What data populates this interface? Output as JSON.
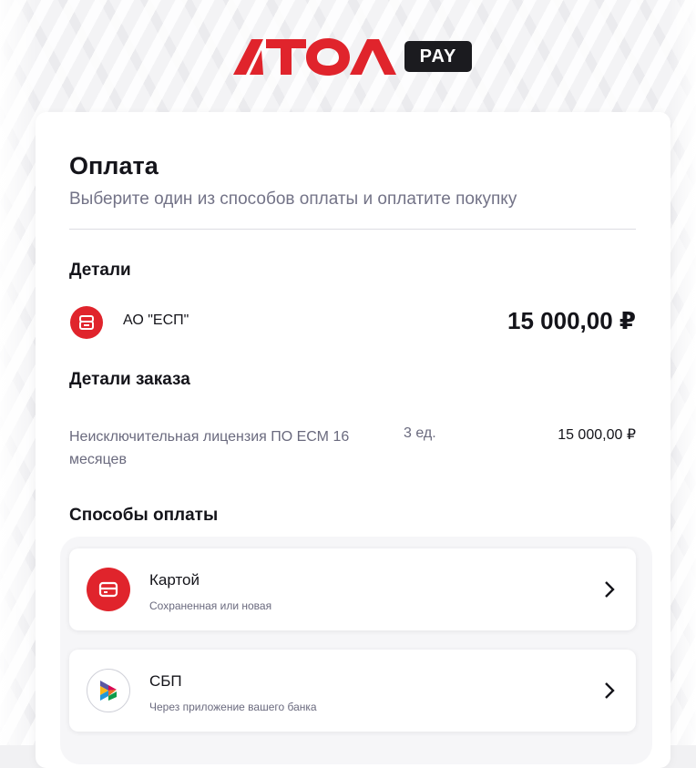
{
  "brand": {
    "logo_text": "ATOL",
    "badge": "PAY",
    "accent": "#e0242c"
  },
  "payment": {
    "title": "Оплата",
    "subtitle": "Выберите один из способов оплаты и оплатите покупку",
    "details_heading": "Детали",
    "merchant_name": "АО \"ЕСП\"",
    "total": "15 000,00 ₽",
    "order_heading": "Детали заказа",
    "order_items": [
      {
        "name": "Неисключительная лицензия ПО ЕСМ 16 месяцев",
        "qty": "3 ед.",
        "price": "15 000,00 ₽"
      }
    ],
    "methods_heading": "Способы оплаты",
    "methods": [
      {
        "title": "Картой",
        "subtitle": "Сохраненная или новая",
        "icon": "card-icon"
      },
      {
        "title": "СБП",
        "subtitle": "Через приложение вашего банка",
        "icon": "sbp-icon"
      }
    ]
  }
}
